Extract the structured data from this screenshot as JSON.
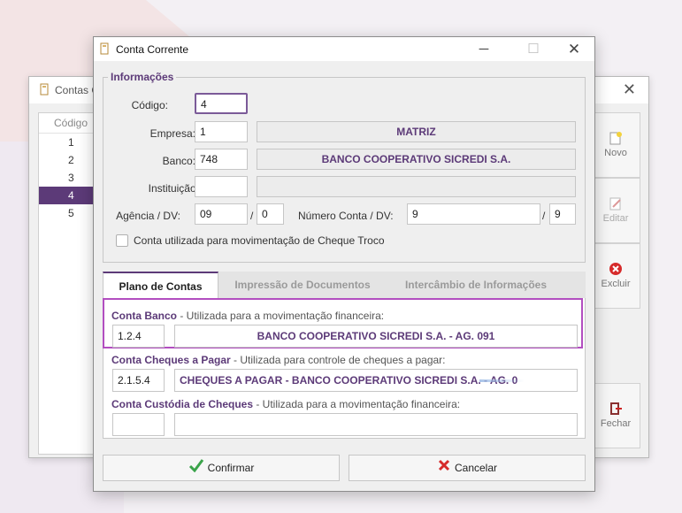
{
  "back_window": {
    "title": "Contas C",
    "list_header": "Código",
    "rows": [
      "1",
      "2",
      "3",
      "4",
      "5"
    ],
    "selected_index": 3,
    "side_buttons": [
      {
        "label": "Novo",
        "icon": "new-icon",
        "enabled": true
      },
      {
        "label": "Editar",
        "icon": "edit-icon",
        "enabled": false
      },
      {
        "label": "Excluir",
        "icon": "delete-icon",
        "enabled": true
      },
      {
        "label": "Fechar",
        "icon": "exit-icon",
        "enabled": true
      }
    ]
  },
  "dialog": {
    "title": "Conta Corrente",
    "info_legend": "Informações",
    "labels": {
      "codigo": "Código:",
      "empresa": "Empresa:",
      "banco": "Banco:",
      "instituicao": "Instituição:",
      "agencia": "Agência / DV:",
      "numero_conta": "Número Conta / DV:",
      "slash1": "/",
      "slash2": "/",
      "cheque_troco": "Conta utilizada para movimentação de Cheque Troco"
    },
    "values": {
      "codigo": "4",
      "empresa": "1",
      "empresa_nome": "MATRIZ",
      "banco": "748",
      "banco_nome": "BANCO COOPERATIVO SICREDI S.A.",
      "instituicao": "",
      "instituicao_nome": "",
      "agencia": "09",
      "agencia_dv": "0",
      "numero_conta": "9",
      "conta_dv": "9",
      "cheque_troco_checked": false
    },
    "tabs": [
      "Plano de Contas",
      "Impressão de Documentos",
      "Intercâmbio de Informações"
    ],
    "active_tab": 0,
    "sections": {
      "conta_banco": {
        "title": "Conta Banco",
        "desc": " - Utilizada para a movimentação financeira:",
        "code": "1.2.4",
        "name": "BANCO COOPERATIVO SICREDI S.A. - AG. 091"
      },
      "cheques_pagar": {
        "title": "Conta Cheques a Pagar",
        "desc": " - Utilizada para controle de cheques a pagar:",
        "code": "2.1.5.4",
        "name": "CHEQUES A PAGAR - BANCO COOPERATIVO SICREDI S.A. - AG. 0"
      },
      "custodia": {
        "title": "Conta Custódia de Cheques",
        "desc": " - Utilizada para a movimentação financeira:",
        "code": "",
        "name": ""
      }
    },
    "buttons": {
      "confirm": "Confirmar",
      "cancel": "Cancelar"
    }
  }
}
